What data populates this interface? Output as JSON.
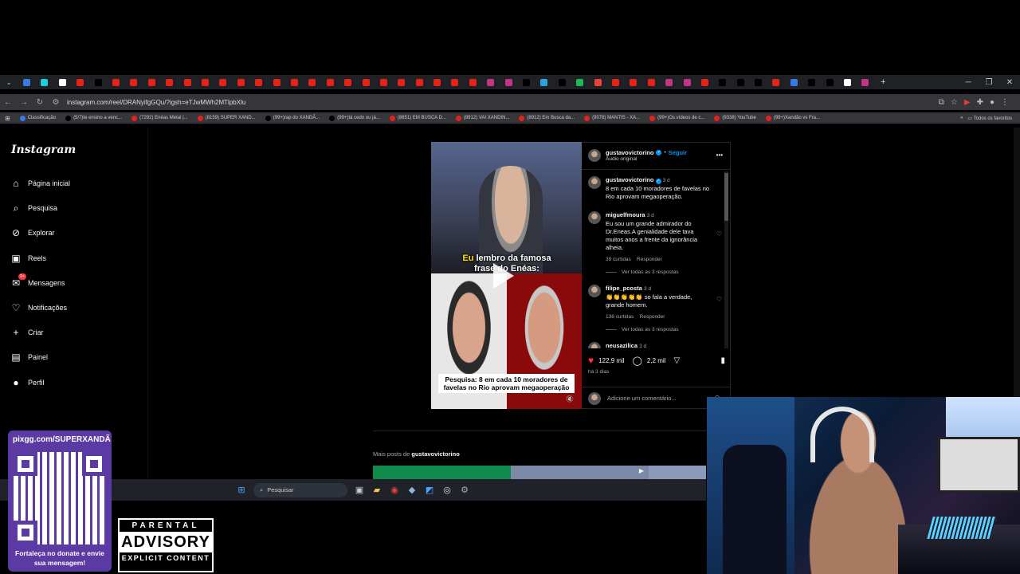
{
  "browser": {
    "url": "instagram.com/reel/DRANyifgGQu/?igsh=eTJwMWh2MTlpbXlu",
    "bookmarks": [
      "Classificação",
      "(5/7)te ensino a venc...",
      "(7292) Enéas Metal |...",
      "(8159) SUPER XAND...",
      "(99+)rap do XANDÃ...",
      "(99+)tá cedo ou já...",
      "(8851) EM BUSCA D...",
      "(8912) VAI XANDIN...",
      "(8912) Em Busca da...",
      "(9078) MANTIS - XA...",
      "(99+)Os vídeos de c...",
      "(9338) YouTube",
      "(99+)Xandão vs Fra..."
    ],
    "bookmarks_folder": "Todos os favoritos"
  },
  "sidebar": {
    "logo": "Instagram",
    "items": [
      {
        "label": "Página inicial",
        "icon": "home-icon"
      },
      {
        "label": "Pesquisa",
        "icon": "search-icon"
      },
      {
        "label": "Explorar",
        "icon": "compass-icon"
      },
      {
        "label": "Reels",
        "icon": "reels-icon"
      },
      {
        "label": "Mensagens",
        "icon": "messenger-icon",
        "badge": "9+"
      },
      {
        "label": "Notificações",
        "icon": "heart-icon"
      },
      {
        "label": "Criar",
        "icon": "plus-icon"
      },
      {
        "label": "Painel",
        "icon": "chart-icon"
      },
      {
        "label": "Perfil",
        "icon": "avatar-icon"
      }
    ]
  },
  "reel": {
    "overlay_line1_highlight": "Eu",
    "overlay_line1_rest": " lembro da famosa",
    "overlay_line2": "frase do Enéas:",
    "caption_box": "Pesquisa: 8 em cada 10 moradores de favelas no Rio aprovam megaoperação"
  },
  "post": {
    "author": "gustavovictorino",
    "follow": "Seguir",
    "audio": "Áudio original",
    "more": "•••",
    "caption_author": "gustavovictorino",
    "caption_time": "3 d",
    "caption_text": "8 em cada 10 moradores de favelas no Rio aprovam megaoperação.",
    "comments": [
      {
        "user": "miguelfmoura",
        "time": "3 d",
        "text": "Eu sou um grande admirador do Dr.Eneas.A genialidade dele tava muitos anos a frente da ignorância alheia.",
        "likes": "39 curtidas",
        "reply": "Responder",
        "view_replies": "Ver todas as 3 respostas"
      },
      {
        "user": "filipe_pcosta",
        "time": "3 d",
        "text": "👏👏👏👏👏 so fala a verdade, grande homem.",
        "likes": "136 curtidas",
        "reply": "Responder",
        "view_replies": "Ver todas as 3 respostas"
      },
      {
        "user": "neusazilica",
        "time": "3 d"
      }
    ],
    "likes": "122,9 mil",
    "comments_count": "2,2 mil",
    "posted": "há 3 dias",
    "add_comment_placeholder": "Adicione um comentário..."
  },
  "more_posts": {
    "prefix": "Mais posts de",
    "author": "gustavovictorino"
  },
  "taskbar": {
    "search_placeholder": "Pesquisar"
  },
  "overlay": {
    "qr_url": "pixgg.com/SUPERXANDÃ",
    "qr_message": "Fortaleça no donate e envie sua mensagem!",
    "advisory_top": "PARENTAL",
    "advisory_mid": "ADVISORY",
    "advisory_bottom": "EXPLICIT CONTENT"
  },
  "colors": {
    "accent_blue": "#0095f6",
    "like_red": "#ff3040",
    "qr_purple": "#5b3aa3"
  }
}
